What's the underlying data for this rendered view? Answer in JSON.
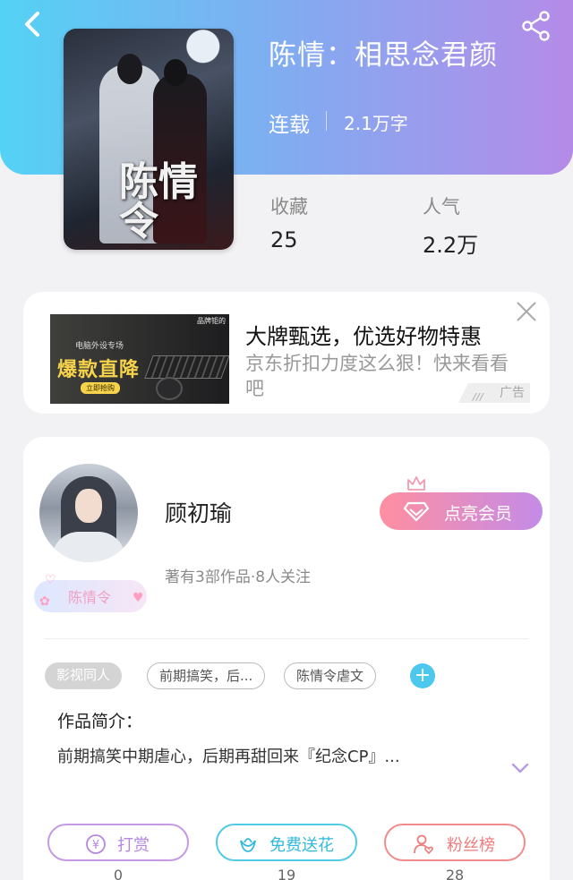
{
  "book": {
    "title": "陈情：相思念君颜",
    "status": "连载",
    "word_count": "2.1万字",
    "cover_text": "陈情令"
  },
  "stats": {
    "favorites_label": "收藏",
    "favorites_value": "25",
    "popularity_label": "人气",
    "popularity_value": "2.2万"
  },
  "ad": {
    "image_brand": "品牌钜的",
    "image_sub": "电脑外设专场",
    "image_headline": "爆款直降",
    "image_button": "立即抢购",
    "title": "大牌甄选，优选好物特惠",
    "description": "京东折扣力度这么狠！快来看看吧",
    "tag": "广告"
  },
  "author": {
    "name": "顾初瑜",
    "meta": "著有3部作品·8人关注",
    "medal": "陈情令",
    "vip_button": "点亮会员"
  },
  "tags": [
    "影视同人",
    "前期搞笑，后...",
    "陈情令虐文"
  ],
  "intro": {
    "heading": "作品简介：",
    "text": "前期搞笑中期虐心，后期再甜回来『纪念CP』..."
  },
  "actions": {
    "reward_label": "打赏",
    "reward_count": "0",
    "flower_label": "免费送花",
    "flower_count": "19",
    "fans_label": "粉丝榜",
    "fans_count": "28"
  },
  "colors": {
    "header_start": "#54d2f5",
    "header_end": "#b58be8",
    "accent_blue": "#4cc8ee",
    "vip_gradient_start": "#ff8fa0",
    "vip_gradient_end": "#c48be8"
  }
}
